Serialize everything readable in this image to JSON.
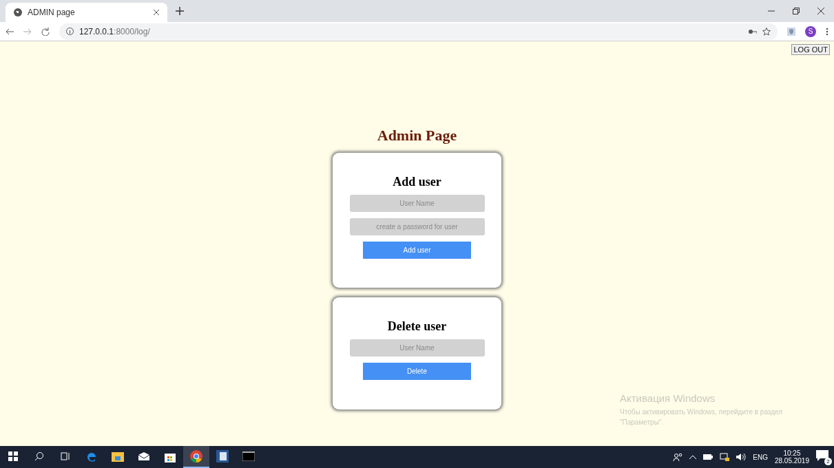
{
  "browser": {
    "tab": {
      "title": "ADMIN page",
      "selected": true
    },
    "url_host": "127.0.0.1",
    "url_path": ":8000/log/",
    "profile_initial": "S"
  },
  "page": {
    "logout": "LOG OUT",
    "title": "Admin Page",
    "cards": [
      {
        "heading": "Add user",
        "fields": [
          {
            "placeholder": "User Name"
          },
          {
            "placeholder": "create a password for user"
          }
        ],
        "button": "Add user"
      },
      {
        "heading": "Delete user",
        "fields": [
          {
            "placeholder": "User Name"
          }
        ],
        "button": "Delete"
      }
    ]
  },
  "activation": {
    "title": "Активация Windows",
    "text": "Чтобы активировать Windows, перейдите в раздел \"Параметры\"."
  },
  "taskbar": {
    "items": [
      {
        "kind": "windows",
        "selected": false
      },
      {
        "kind": "search",
        "selected": false
      },
      {
        "kind": "taskview",
        "selected": false
      },
      {
        "kind": "edge",
        "selected": false
      },
      {
        "kind": "folder",
        "selected": false
      },
      {
        "kind": "mail",
        "selected": false
      },
      {
        "kind": "store",
        "selected": false
      },
      {
        "kind": "chrome",
        "selected": true
      },
      {
        "kind": "word",
        "selected": false
      },
      {
        "kind": "terminal",
        "selected": false
      }
    ],
    "language": "ENG",
    "time": "10:25",
    "date": "28.05.2019",
    "notifications": "2"
  }
}
